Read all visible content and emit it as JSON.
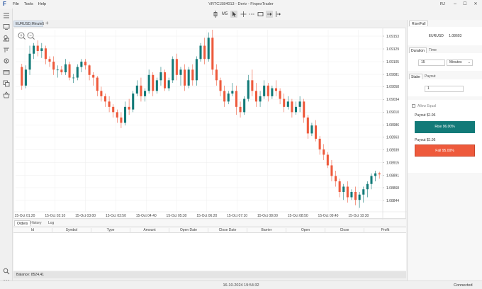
{
  "window": {
    "logo": "F",
    "menu": [
      "File",
      "Tools",
      "Help"
    ],
    "title": "VRTC1584013 - Deriv - FinpexTrader",
    "user_initials": "RJ",
    "controls": {
      "minimize": "–",
      "maximize": "☐",
      "close": "✕"
    }
  },
  "toolbar": {
    "timeframe": "M5"
  },
  "chart": {
    "tab_label": "EURUSD,Minute5",
    "add_tab": "+",
    "zoom_in": "+",
    "zoom_out": "−"
  },
  "chart_data": {
    "type": "candlestick",
    "symbol": "EURUSD,Minute5",
    "y_ticks": [
      "1.09153",
      "1.09129",
      "1.09105",
      "1.09081",
      "1.09058",
      "1.09034",
      "1.09010",
      "1.08986",
      "1.08963",
      "1.08939",
      "1.08915",
      "1.08891",
      "1.08868",
      "1.08844"
    ],
    "ylim": [
      1.08828,
      1.09165
    ],
    "x_ticks": [
      "15-Oct 01:20",
      "15-Oct 02:10",
      "15-Oct 03:00",
      "15-Oct 03:50",
      "15-Oct 04:40",
      "15-Oct 05:30",
      "15-Oct 06:20",
      "15-Oct 07:10",
      "15-Oct 08:00",
      "15-Oct 08:50",
      "15-Oct 09:40",
      "15-Oct 10:30"
    ],
    "grid": true,
    "colors": {
      "up": "#127a78",
      "down": "#ee5a3c"
    },
    "candles": [
      [
        1.09095,
        1.09101,
        1.09052,
        1.0906
      ],
      [
        1.0906,
        1.09098,
        1.09055,
        1.0909
      ],
      [
        1.0909,
        1.09135,
        1.0908,
        1.0912
      ],
      [
        1.0912,
        1.0914,
        1.0911,
        1.09135
      ],
      [
        1.09135,
        1.09145,
        1.09115,
        1.09125
      ],
      [
        1.09125,
        1.0914,
        1.09112,
        1.0913
      ],
      [
        1.0913,
        1.09135,
        1.091,
        1.0911
      ],
      [
        1.0911,
        1.09115,
        1.09095,
        1.09105
      ],
      [
        1.09105,
        1.09115,
        1.0908,
        1.0909
      ],
      [
        1.0909,
        1.09098,
        1.09075,
        1.0909
      ],
      [
        1.0909,
        1.09097,
        1.0908,
        1.09085
      ],
      [
        1.09085,
        1.0911,
        1.0908,
        1.091
      ],
      [
        1.091,
        1.09105,
        1.0907,
        1.09075
      ],
      [
        1.09075,
        1.09082,
        1.09065,
        1.09075
      ],
      [
        1.09075,
        1.091,
        1.0907,
        1.09095
      ],
      [
        1.09095,
        1.0911,
        1.09085,
        1.09105
      ],
      [
        1.09105,
        1.0911,
        1.0909,
        1.09098
      ],
      [
        1.09098,
        1.091,
        1.0907,
        1.0908
      ],
      [
        1.0908,
        1.09085,
        1.0906,
        1.09075
      ],
      [
        1.09075,
        1.09078,
        1.0904,
        1.0905
      ],
      [
        1.0905,
        1.09058,
        1.0903,
        1.0904
      ],
      [
        1.0904,
        1.09045,
        1.0902,
        1.0903
      ],
      [
        1.0903,
        1.0904,
        1.0901,
        1.0902
      ],
      [
        1.0902,
        1.09025,
        1.09,
        1.0901
      ],
      [
        1.0901,
        1.09015,
        1.0899,
        1.09
      ],
      [
        1.09,
        1.0901,
        1.0898,
        1.0899
      ],
      [
        1.0899,
        1.0903,
        1.08985,
        1.0902
      ],
      [
        1.0902,
        1.09035,
        1.09005,
        1.09015
      ],
      [
        1.09015,
        1.0905,
        1.0901,
        1.09045
      ],
      [
        1.09045,
        1.0907,
        1.0904,
        1.0906
      ],
      [
        1.0906,
        1.09075,
        1.0903,
        1.0904
      ],
      [
        1.0904,
        1.09055,
        1.0903,
        1.0905
      ],
      [
        1.0905,
        1.0909,
        1.09045,
        1.0908
      ],
      [
        1.0908,
        1.09085,
        1.0904,
        1.0905
      ],
      [
        1.0905,
        1.09075,
        1.09045,
        1.0907
      ],
      [
        1.0907,
        1.09095,
        1.0906,
        1.09085
      ],
      [
        1.09085,
        1.0909,
        1.0905,
        1.09055
      ],
      [
        1.09055,
        1.09075,
        1.0905,
        1.0907
      ],
      [
        1.0907,
        1.09115,
        1.09065,
        1.0911
      ],
      [
        1.0911,
        1.0912,
        1.0907,
        1.0908
      ],
      [
        1.0908,
        1.09095,
        1.0906,
        1.0909
      ],
      [
        1.0909,
        1.091,
        1.0905,
        1.0906
      ],
      [
        1.0906,
        1.09095,
        1.09055,
        1.0909
      ],
      [
        1.0909,
        1.091,
        1.0906,
        1.0907
      ],
      [
        1.0907,
        1.09115,
        1.0906,
        1.0911
      ],
      [
        1.0911,
        1.0914,
        1.09105,
        1.09135
      ],
      [
        1.09135,
        1.0915,
        1.091,
        1.0911
      ],
      [
        1.0911,
        1.0916,
        1.09105,
        1.0915
      ],
      [
        1.0915,
        1.09165,
        1.0908,
        1.0909
      ],
      [
        1.0909,
        1.091,
        1.0906,
        1.0907
      ],
      [
        1.0907,
        1.09075,
        1.0904,
        1.0905
      ],
      [
        1.0905,
        1.0906,
        1.0902,
        1.0903
      ],
      [
        1.0903,
        1.0905,
        1.09025,
        1.09045
      ],
      [
        1.09045,
        1.09065,
        1.0904,
        1.0905
      ],
      [
        1.0905,
        1.0906,
        1.09005,
        1.0902
      ],
      [
        1.0902,
        1.0903,
        1.09,
        1.0901
      ],
      [
        1.0901,
        1.0904,
        1.09005,
        1.09035
      ],
      [
        1.09035,
        1.0908,
        1.0903,
        1.0907
      ],
      [
        1.0907,
        1.0909,
        1.0904,
        1.0905
      ],
      [
        1.0905,
        1.09065,
        1.0902,
        1.0903
      ],
      [
        1.0903,
        1.0905,
        1.0902,
        1.0904
      ],
      [
        1.0904,
        1.0907,
        1.09035,
        1.0906
      ],
      [
        1.0906,
        1.09065,
        1.0903,
        1.0904
      ],
      [
        1.0904,
        1.0906,
        1.09035,
        1.09055
      ],
      [
        1.09055,
        1.0907,
        1.0904,
        1.0905
      ],
      [
        1.0905,
        1.09055,
        1.09025,
        1.09035
      ],
      [
        1.09035,
        1.09045,
        1.0901,
        1.0902
      ],
      [
        1.0902,
        1.0904,
        1.09015,
        1.0903
      ],
      [
        1.0903,
        1.09035,
        1.09,
        1.0901
      ],
      [
        1.0901,
        1.0903,
        1.09005,
        1.0902
      ],
      [
        1.0902,
        1.0904,
        1.0901,
        1.0903
      ],
      [
        1.0903,
        1.09035,
        1.0899,
        1.09
      ],
      [
        1.09,
        1.09005,
        1.0896,
        1.0897
      ],
      [
        1.0897,
        1.0899,
        1.08965,
        1.08985
      ],
      [
        1.08985,
        1.08995,
        1.08955,
        1.0896
      ],
      [
        1.0896,
        1.08965,
        1.0893,
        1.0894
      ],
      [
        1.0894,
        1.0895,
        1.0892,
        1.0893
      ],
      [
        1.0893,
        1.08935,
        1.08905,
        1.0891
      ],
      [
        1.0891,
        1.0892,
        1.0888,
        1.0889
      ],
      [
        1.0889,
        1.089,
        1.0887,
        1.0888
      ],
      [
        1.0888,
        1.08885,
        1.0885,
        1.0886
      ],
      [
        1.0886,
        1.08875,
        1.08845,
        1.0887
      ],
      [
        1.0887,
        1.0888,
        1.0884,
        1.0885
      ],
      [
        1.0885,
        1.08865,
        1.08845,
        1.0886
      ],
      [
        1.0886,
        1.0887,
        1.08835,
        1.08845
      ],
      [
        1.08845,
        1.0886,
        1.0883,
        1.08855
      ],
      [
        1.08855,
        1.0887,
        1.0884,
        1.08865
      ],
      [
        1.08865,
        1.0888,
        1.0885,
        1.08875
      ],
      [
        1.08875,
        1.08895,
        1.08865,
        1.0889
      ],
      [
        1.0889,
        1.089,
        1.0888,
        1.08895
      ],
      [
        1.08895,
        1.08898,
        1.08885,
        1.08893
      ]
    ]
  },
  "orders": {
    "tabs": [
      "Orders",
      "History",
      "Log"
    ],
    "columns": [
      "Id",
      "Symbol",
      "Type",
      "Amount",
      "Open Date",
      "Close Date",
      "Barrier",
      "Open",
      "Close",
      "Profit"
    ],
    "balance": "Balance: 8524.41"
  },
  "status": {
    "datetime": "16-10-2024 19:54:32",
    "connection": "Connected"
  },
  "trade_panel": {
    "tab": "Rise/Fall",
    "symbol": "EURUSD",
    "price": "1.08603",
    "duration_tabs": [
      "Duration",
      "Time"
    ],
    "duration_value": "15",
    "duration_unit": "Minutes",
    "amount_tabs": [
      "Stake",
      "Payout"
    ],
    "amount_value": "1",
    "allow_equal": "Allow Equal",
    "rise_payout": "Payout $1.96",
    "rise_button": "Rise 96.00%",
    "fall_payout": "Payout $1.95",
    "fall_button": "Fall 95.00%",
    "colors": {
      "rise": "#127a78",
      "fall": "#ee5a3c"
    }
  }
}
